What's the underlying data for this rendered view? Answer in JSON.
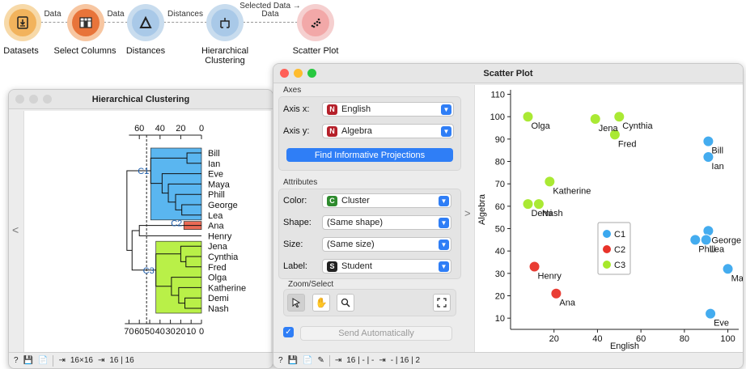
{
  "workflow": {
    "nodes": [
      {
        "label": "Datasets",
        "icon": "datasets-icon"
      },
      {
        "label": "Select Columns",
        "icon": "select-columns-icon"
      },
      {
        "label": "Distances",
        "icon": "distances-icon"
      },
      {
        "label": "Hierarchical\nClustering",
        "icon": "hierarchical-clustering-icon"
      },
      {
        "label": "Scatter Plot",
        "icon": "scatter-plot-icon"
      }
    ],
    "links": [
      "Data",
      "Data",
      "Distances",
      "Selected Data →\nData"
    ]
  },
  "hc_window": {
    "title": "Hierarchical Clustering",
    "top_axis": [
      "60",
      "40",
      "20",
      "0"
    ],
    "bottom_axis": [
      "70",
      "60",
      "50",
      "40",
      "30",
      "20",
      "10",
      "0"
    ],
    "leaves": [
      "Bill",
      "Ian",
      "Eve",
      "Maya",
      "Phill",
      "George",
      "Lea",
      "Ana",
      "Henry",
      "Jena",
      "Cynthia",
      "Fred",
      "Olga",
      "Katherine",
      "Demi",
      "Nash"
    ],
    "cluster_labels": [
      "C1",
      "C2",
      "C3"
    ],
    "nav_arrow": "<",
    "status": {
      "input": "16×16",
      "output": "16 | 16"
    }
  },
  "sp_window": {
    "title": "Scatter Plot",
    "axes_section": "Axes",
    "axis_x_label": "Axis x:",
    "axis_x_value": "English",
    "axis_y_label": "Axis y:",
    "axis_y_value": "Algebra",
    "find_button": "Find Informative Projections",
    "attributes_section": "Attributes",
    "color_label": "Color:",
    "color_value": "Cluster",
    "shape_label": "Shape:",
    "shape_value": "(Same shape)",
    "size_label": "Size:",
    "size_value": "(Same size)",
    "label_label": "Label:",
    "label_value": "Student",
    "zoom_section": "Zoom/Select",
    "send_button": "Send Automatically",
    "collapse_arrow": ">",
    "status": {
      "input": "16 | - | -",
      "output": "- | 16 | 2"
    },
    "badge_numeric": "N",
    "badge_categorical": "C",
    "badge_string": "S"
  },
  "colors": {
    "C1": "#3aa8ef",
    "C2": "#e8332a",
    "C3": "#a6e82a",
    "C1_fill": "#5ab6f0",
    "C2_fill": "#ea6a55",
    "C3_fill": "#b9f048",
    "accent": "#2f7ef6"
  },
  "chart_data": {
    "type": "scatter",
    "xlabel": "English",
    "ylabel": "Algebra",
    "xlim": [
      0,
      105
    ],
    "ylim": [
      5,
      112
    ],
    "xticks": [
      20,
      40,
      60,
      80,
      100
    ],
    "yticks": [
      10,
      20,
      30,
      40,
      50,
      60,
      70,
      80,
      90,
      100,
      110
    ],
    "legend": [
      "C1",
      "C2",
      "C3"
    ],
    "legend_position": "center",
    "grid": false,
    "points": [
      {
        "name": "Bill",
        "x": 91,
        "y": 89,
        "cluster": "C1"
      },
      {
        "name": "Ian",
        "x": 91,
        "y": 82,
        "cluster": "C1"
      },
      {
        "name": "George",
        "x": 91,
        "y": 49,
        "cluster": "C1"
      },
      {
        "name": "Phill",
        "x": 85,
        "y": 45,
        "cluster": "C1"
      },
      {
        "name": "Lea",
        "x": 90,
        "y": 45,
        "cluster": "C1"
      },
      {
        "name": "Maya",
        "x": 100,
        "y": 32,
        "cluster": "C1"
      },
      {
        "name": "Eve",
        "x": 92,
        "y": 12,
        "cluster": "C1"
      },
      {
        "name": "Henry",
        "x": 11,
        "y": 33,
        "cluster": "C2"
      },
      {
        "name": "Ana",
        "x": 21,
        "y": 21,
        "cluster": "C2"
      },
      {
        "name": "Olga",
        "x": 8,
        "y": 100,
        "cluster": "C3"
      },
      {
        "name": "Jena",
        "x": 39,
        "y": 99,
        "cluster": "C3"
      },
      {
        "name": "Cynthia",
        "x": 50,
        "y": 100,
        "cluster": "C3"
      },
      {
        "name": "Fred",
        "x": 48,
        "y": 92,
        "cluster": "C3"
      },
      {
        "name": "Katherine",
        "x": 18,
        "y": 71,
        "cluster": "C3"
      },
      {
        "name": "Demi",
        "x": 8,
        "y": 61,
        "cluster": "C3"
      },
      {
        "name": "Nash",
        "x": 13,
        "y": 61,
        "cluster": "C3"
      }
    ]
  }
}
